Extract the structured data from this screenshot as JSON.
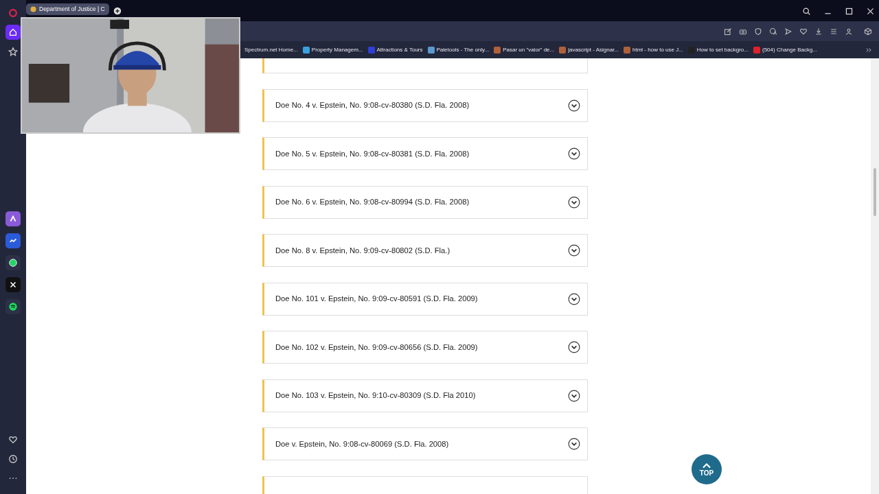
{
  "tab": {
    "title": "Department of Justice | C",
    "selected": true
  },
  "bookmarks": [
    {
      "label": "Spectrum.net Home..."
    },
    {
      "label": "Property Managem..."
    },
    {
      "label": "Attractions & Tours"
    },
    {
      "label": "Paletools - The only..."
    },
    {
      "label": "Pasar un \"valor\" de..."
    },
    {
      "label": "javascript - Asignar..."
    },
    {
      "label": "html - how to use J..."
    },
    {
      "label": "How to set backgro..."
    },
    {
      "label": "(504) Change Backg..."
    }
  ],
  "accordion": [
    {
      "label": "Doe No. 4 v. Epstein, No. 9:08-cv-80380 (S.D. Fla. 2008)",
      "expanded": false
    },
    {
      "label": "Doe No. 5 v. Epstein, No. 9:08-cv-80381 (S.D. Fla. 2008)",
      "expanded": false
    },
    {
      "label": "Doe No. 6 v. Epstein, No. 9:08-cv-80994 (S.D. Fla. 2008)",
      "expanded": false
    },
    {
      "label": "Doe No. 8 v. Epstein, No. 9:09-cv-80802 (S.D. Fla.)",
      "expanded": false
    },
    {
      "label": "Doe No. 101 v. Epstein, No. 9:09-cv-80591 (S.D. Fla. 2009)",
      "expanded": false
    },
    {
      "label": "Doe No. 102 v. Epstein, No. 9:09-cv-80656 (S.D. Fla. 2009)",
      "expanded": false
    },
    {
      "label": "Doe No. 103 v. Epstein, No. 9:10-cv-80309 (S.D. Fla 2010)",
      "expanded": false
    },
    {
      "label": "Doe v. Epstein, No. 9:08-cv-80069 (S.D. Fla. 2008)",
      "expanded": false
    }
  ],
  "top_button": {
    "label": "TOP"
  }
}
